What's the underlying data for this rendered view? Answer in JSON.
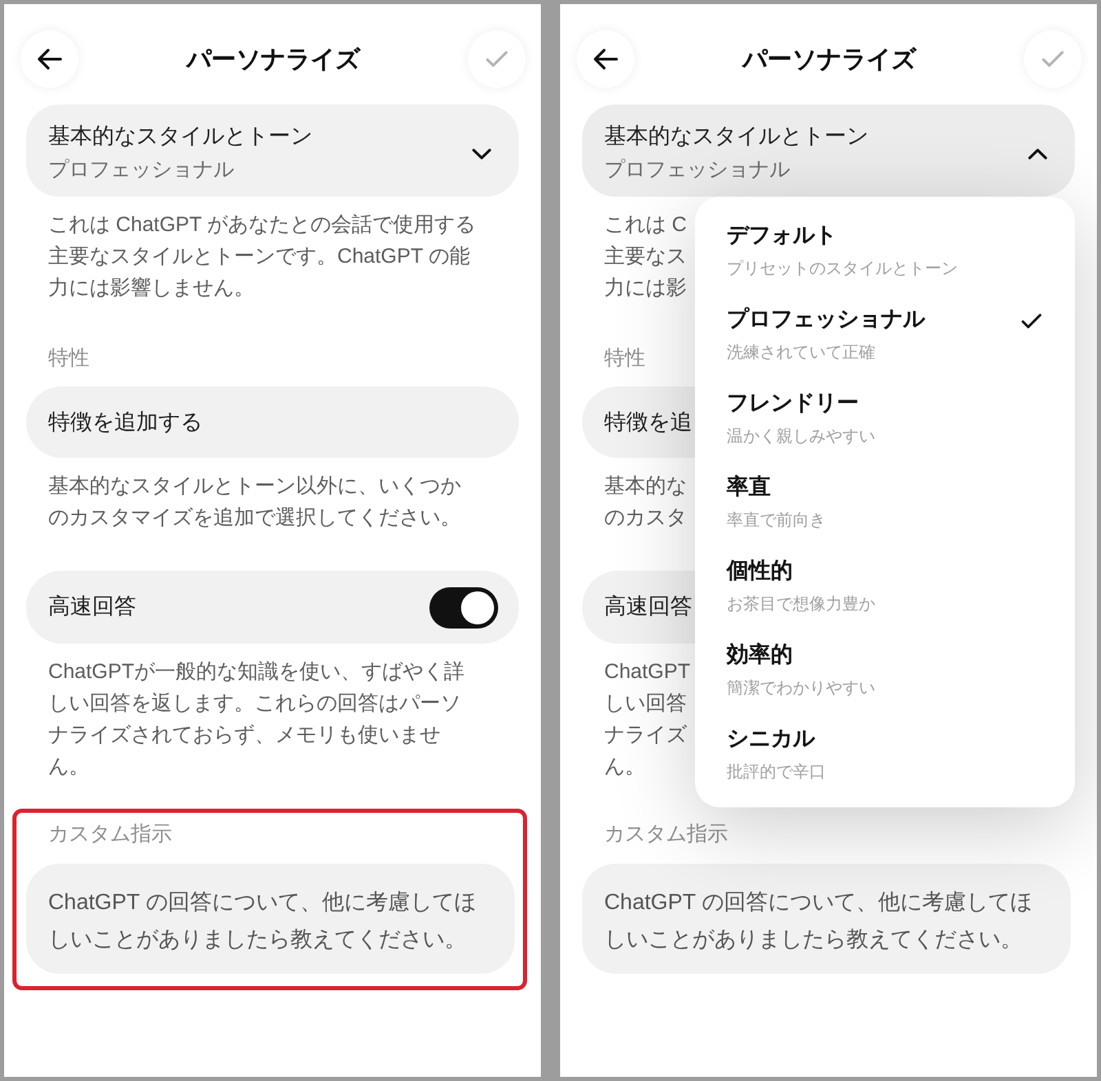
{
  "screens": [
    {
      "header": {
        "title": "パーソナライズ",
        "save_disabled": true
      },
      "style_select": {
        "label": "基本的なスタイルとトーン",
        "value": "プロフェッショナル",
        "expanded": false
      },
      "style_note": "これは ChatGPT があなたとの会話で使用する主要なスタイルとトーンです。ChatGPT の能力には影響しません。",
      "traits": {
        "heading": "特性",
        "add_button": "特徴を追加する",
        "note": "基本的なスタイルとトーン以外に、いくつかのカスタマイズを追加で選択してください。"
      },
      "fast_answers": {
        "label": "高速回答",
        "on": true,
        "note": "ChatGPTが一般的な知識を使い、すばやく詳しい回答を返します。これらの回答はパーソナライズされておらず、メモリも使いません。"
      },
      "custom_instructions": {
        "heading": "カスタム指示",
        "placeholder": "ChatGPT の回答について、他に考慮してほしいことがありましたら教えてください。",
        "highlighted": true
      }
    },
    {
      "header": {
        "title": "パーソナライズ",
        "save_disabled": true
      },
      "style_select": {
        "label": "基本的なスタイルとトーン",
        "value": "プロフェッショナル",
        "expanded": true
      },
      "style_menu": [
        {
          "title": "デフォルト",
          "subtitle": "プリセットのスタイルとトーン",
          "selected": false
        },
        {
          "title": "プロフェッショナル",
          "subtitle": "洗練されていて正確",
          "selected": true
        },
        {
          "title": "フレンドリー",
          "subtitle": "温かく親しみやすい",
          "selected": false
        },
        {
          "title": "率直",
          "subtitle": "率直で前向き",
          "selected": false
        },
        {
          "title": "個性的",
          "subtitle": "お茶目で想像力豊か",
          "selected": false
        },
        {
          "title": "効率的",
          "subtitle": "簡潔でわかりやすい",
          "selected": false
        },
        {
          "title": "シニカル",
          "subtitle": "批評的で辛口",
          "selected": false
        }
      ],
      "style_note": [
        "これは C",
        "主要なス",
        "力には影"
      ],
      "traits": {
        "heading": "特性",
        "add_button": "特徴を追",
        "note": [
          "基本的な",
          "のカスタ"
        ]
      },
      "fast_answers": {
        "label": "高速回答",
        "note": [
          "ChatGPT",
          "しい回答",
          "ナライズ",
          "ん。"
        ]
      },
      "custom_instructions": {
        "heading": "カスタム指示",
        "placeholder": "ChatGPT の回答について、他に考慮してほしいことがありましたら教えてください。"
      }
    }
  ]
}
